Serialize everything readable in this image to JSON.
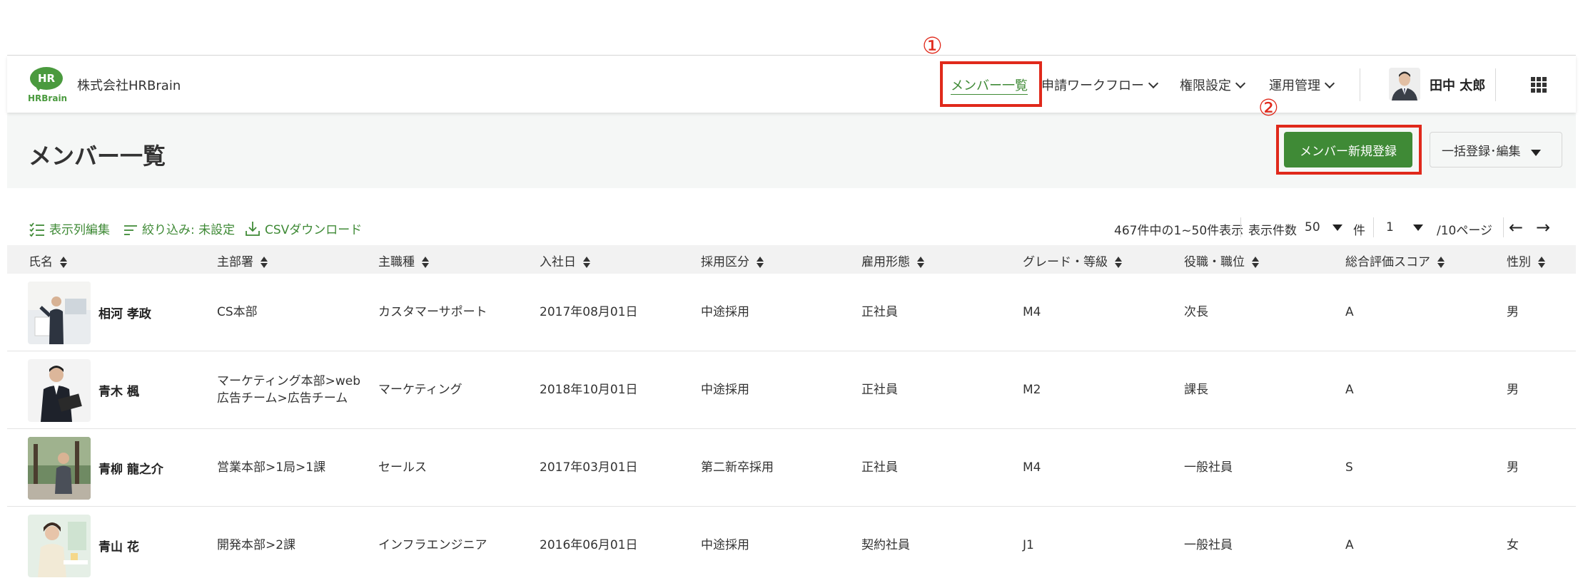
{
  "header": {
    "logo_text": "HR",
    "logo_word": "HRBrain",
    "company": "株式会社HRBrain",
    "nav": [
      {
        "label": "メンバー一覧"
      },
      {
        "label": "申請ワークフロー"
      },
      {
        "label": "権限設定"
      },
      {
        "label": "運用管理"
      }
    ],
    "user_name": "田中 太郎"
  },
  "annotations": {
    "one": "①",
    "two": "②"
  },
  "page": {
    "title": "メンバー一覧",
    "primary_button": "メンバー新規登録",
    "secondary_button": "一括登録･編集"
  },
  "toolbar": {
    "column_edit": "表示列編集",
    "filter": "絞り込み: 未設定",
    "csv": "CSVダウンロード",
    "summary": "467件中の1~50件表示",
    "per_page_label": "表示件数",
    "per_page_value": "50",
    "per_page_unit": "件",
    "page_value": "1",
    "page_total": "/10ページ"
  },
  "table": {
    "columns": [
      "氏名",
      "主部署",
      "主職種",
      "入社日",
      "採用区分",
      "雇用形態",
      "グレード・等級",
      "役職・職位",
      "総合評価スコア",
      "性別"
    ],
    "rows": [
      {
        "name": "相河 孝政",
        "dept": [
          "CS本部"
        ],
        "job": "カスタマーサポート",
        "joined": "2017年08月01日",
        "hire": "中途採用",
        "employment": "正社員",
        "grade": "M4",
        "position": "次長",
        "score": "A",
        "gender": "男"
      },
      {
        "name": "青木 楓",
        "dept": [
          "マーケティング本部>web",
          "広告チーム>広告チーム"
        ],
        "job": "マーケティング",
        "joined": "2018年10月01日",
        "hire": "中途採用",
        "employment": "正社員",
        "grade": "M2",
        "position": "課長",
        "score": "A",
        "gender": "男"
      },
      {
        "name": "青柳 龍之介",
        "dept": [
          "営業本部>1局>1課"
        ],
        "job": "セールス",
        "joined": "2017年03月01日",
        "hire": "第二新卒採用",
        "employment": "正社員",
        "grade": "M4",
        "position": "一般社員",
        "score": "S",
        "gender": "男"
      },
      {
        "name": "青山 花",
        "dept": [
          "開発本部>2課"
        ],
        "job": "インフラエンジニア",
        "joined": "2016年06月01日",
        "hire": "中途採用",
        "employment": "契約社員",
        "grade": "J1",
        "position": "一般社員",
        "score": "A",
        "gender": "女"
      }
    ]
  },
  "colors": {
    "brand_green": "#3f8a36",
    "annotation_red": "#e0291b"
  },
  "icons": [
    "checklist-icon",
    "filter-icon",
    "download-icon",
    "grid-apps-icon",
    "arrow-left-icon",
    "arrow-right-icon",
    "chevron-down-icon",
    "sort-icon"
  ]
}
